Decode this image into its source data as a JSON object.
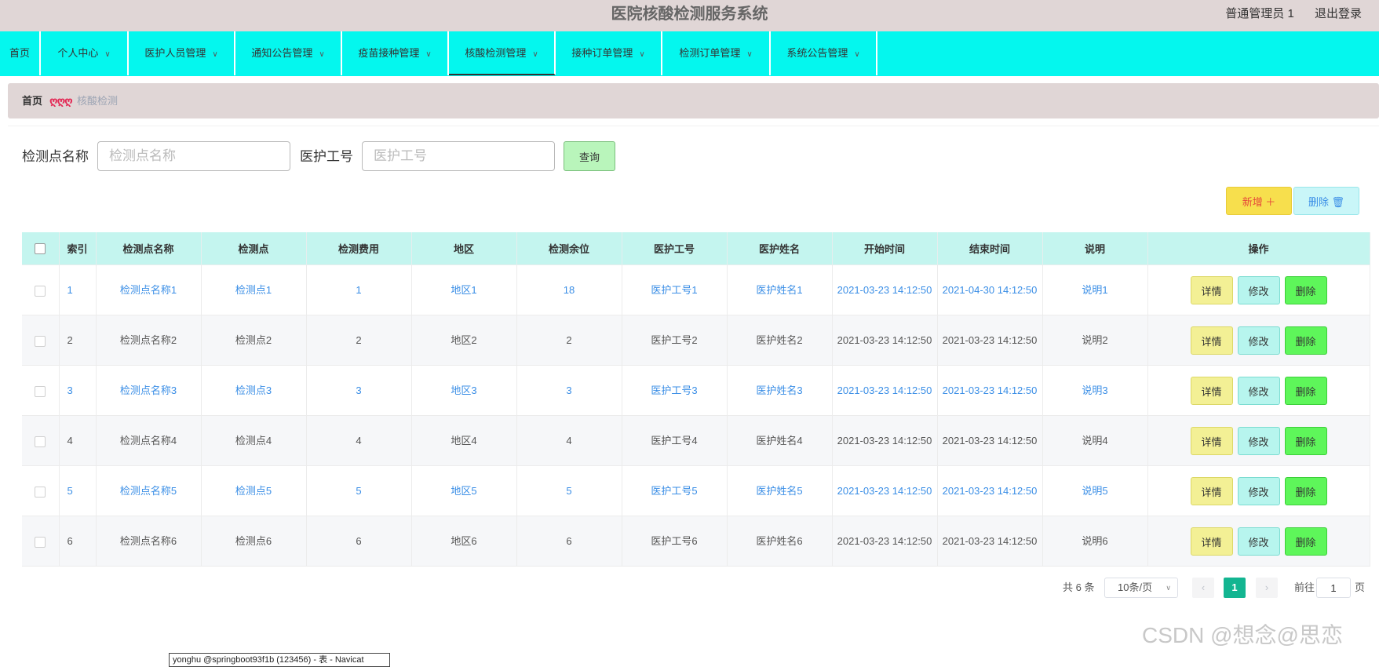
{
  "header": {
    "title": "医院核酸检测服务系统",
    "user": "普通管理员 1",
    "logout": "退出登录"
  },
  "nav": {
    "items": [
      {
        "label": "首页",
        "dropdown": false
      },
      {
        "label": "个人中心",
        "dropdown": true
      },
      {
        "label": "医护人员管理",
        "dropdown": true
      },
      {
        "label": "通知公告管理",
        "dropdown": true
      },
      {
        "label": "疫苗接种管理",
        "dropdown": true
      },
      {
        "label": "核酸检测管理",
        "dropdown": true,
        "active": true
      },
      {
        "label": "接种订单管理",
        "dropdown": true
      },
      {
        "label": "检测订单管理",
        "dropdown": true
      },
      {
        "label": "系统公告管理",
        "dropdown": true
      }
    ]
  },
  "breadcrumb": {
    "home": "首页",
    "separator": "ღღღ",
    "current": "核酸检测"
  },
  "search": {
    "site_name_label": "检测点名称",
    "site_name_placeholder": "检测点名称",
    "staff_no_label": "医护工号",
    "staff_no_placeholder": "医护工号",
    "query_button": "查询"
  },
  "actions": {
    "add_label": "新增 ＋",
    "delete_label": "删除 🗑"
  },
  "table": {
    "columns": [
      "索引",
      "检测点名称",
      "检测点",
      "检测费用",
      "地区",
      "检测余位",
      "医护工号",
      "医护姓名",
      "开始时间",
      "结束时间",
      "说明",
      "操作"
    ],
    "rows": [
      {
        "index": "1",
        "site_name": "检测点名称1",
        "site": "检测点1",
        "fee": "1",
        "region": "地区1",
        "remaining": "18",
        "staff_no": "医护工号1",
        "staff_name": "医护姓名1",
        "start": "2021-03-23 14:12:50",
        "end": "2021-04-30 14:12:50",
        "note": "说明1"
      },
      {
        "index": "2",
        "site_name": "检测点名称2",
        "site": "检测点2",
        "fee": "2",
        "region": "地区2",
        "remaining": "2",
        "staff_no": "医护工号2",
        "staff_name": "医护姓名2",
        "start": "2021-03-23 14:12:50",
        "end": "2021-03-23 14:12:50",
        "note": "说明2"
      },
      {
        "index": "3",
        "site_name": "检测点名称3",
        "site": "检测点3",
        "fee": "3",
        "region": "地区3",
        "remaining": "3",
        "staff_no": "医护工号3",
        "staff_name": "医护姓名3",
        "start": "2021-03-23 14:12:50",
        "end": "2021-03-23 14:12:50",
        "note": "说明3"
      },
      {
        "index": "4",
        "site_name": "检测点名称4",
        "site": "检测点4",
        "fee": "4",
        "region": "地区4",
        "remaining": "4",
        "staff_no": "医护工号4",
        "staff_name": "医护姓名4",
        "start": "2021-03-23 14:12:50",
        "end": "2021-03-23 14:12:50",
        "note": "说明4"
      },
      {
        "index": "5",
        "site_name": "检测点名称5",
        "site": "检测点5",
        "fee": "5",
        "region": "地区5",
        "remaining": "5",
        "staff_no": "医护工号5",
        "staff_name": "医护姓名5",
        "start": "2021-03-23 14:12:50",
        "end": "2021-03-23 14:12:50",
        "note": "说明5"
      },
      {
        "index": "6",
        "site_name": "检测点名称6",
        "site": "检测点6",
        "fee": "6",
        "region": "地区6",
        "remaining": "6",
        "staff_no": "医护工号6",
        "staff_name": "医护姓名6",
        "start": "2021-03-23 14:12:50",
        "end": "2021-03-23 14:12:50",
        "note": "说明6"
      }
    ],
    "row_actions": {
      "detail": "详情",
      "edit": "修改",
      "delete": "删除"
    }
  },
  "pagination": {
    "total": "共 6 条",
    "page_size": "10条/页",
    "current_page": "1",
    "goto_label": "前往",
    "goto_value": "1",
    "page_suffix": "页"
  },
  "watermark": "CSDN @想念@思恋",
  "tooltip": "yonghu @springboot93f1b (123456) - 表 - Navicat"
}
